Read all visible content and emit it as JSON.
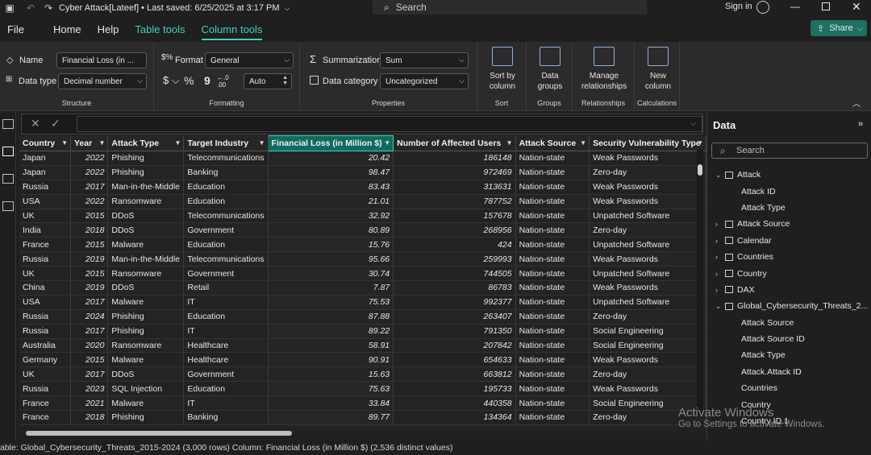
{
  "titlebar": {
    "title": "Cyber Attack[Lateef] • Last saved: 6/25/2025 at 3:17 PM",
    "search_placeholder": "Search",
    "sign_in": "Sign in"
  },
  "menu": {
    "file": "File",
    "home": "Home",
    "help": "Help",
    "table_tools": "Table tools",
    "column_tools": "Column tools",
    "share": "Share"
  },
  "ribbon": {
    "structure": {
      "name_label": "Name",
      "name_value": "Financial Loss (in ...",
      "datatype_label": "Data type",
      "datatype_value": "Decimal number",
      "group": "Structure"
    },
    "formatting": {
      "format_label": "Format",
      "format_value": "General",
      "decimals": "Auto",
      "group": "Formatting"
    },
    "properties": {
      "summarization_label": "Summarization",
      "summarization_value": "Sum",
      "category_label": "Data category",
      "category_value": "Uncategorized",
      "group": "Properties"
    },
    "sort": {
      "label_line1": "Sort by",
      "label_line2": "column",
      "group": "Sort"
    },
    "groups": {
      "label_line1": "Data",
      "label_line2": "groups",
      "group": "Groups"
    },
    "relationships": {
      "label_line1": "Manage",
      "label_line2": "relationships",
      "group": "Relationships"
    },
    "calculations": {
      "label_line1": "New",
      "label_line2": "column",
      "group": "Calculations"
    }
  },
  "table": {
    "columns": [
      "Country",
      "Year",
      "Attack Type",
      "Target Industry",
      "Financial Loss (in Million $)",
      "Number of Affected Users",
      "Attack Source",
      "Security Vulnerability Type"
    ],
    "rows": [
      [
        "Japan",
        "2022",
        "Phishing",
        "Telecommunications",
        "20.42",
        "186148",
        "Nation-state",
        "Weak Passwords"
      ],
      [
        "Japan",
        "2022",
        "Phishing",
        "Banking",
        "98.47",
        "972469",
        "Nation-state",
        "Zero-day"
      ],
      [
        "Russia",
        "2017",
        "Man-in-the-Middle",
        "Education",
        "83.43",
        "313631",
        "Nation-state",
        "Weak Passwords"
      ],
      [
        "USA",
        "2022",
        "Ransomware",
        "Education",
        "21.01",
        "787752",
        "Nation-state",
        "Weak Passwords"
      ],
      [
        "UK",
        "2015",
        "DDoS",
        "Telecommunications",
        "32.92",
        "157678",
        "Nation-state",
        "Unpatched Software"
      ],
      [
        "India",
        "2018",
        "DDoS",
        "Government",
        "80.89",
        "268956",
        "Nation-state",
        "Zero-day"
      ],
      [
        "France",
        "2015",
        "Malware",
        "Education",
        "15.76",
        "424",
        "Nation-state",
        "Unpatched Software"
      ],
      [
        "Russia",
        "2019",
        "Man-in-the-Middle",
        "Telecommunications",
        "95.66",
        "259993",
        "Nation-state",
        "Weak Passwords"
      ],
      [
        "UK",
        "2015",
        "Ransomware",
        "Government",
        "30.74",
        "744505",
        "Nation-state",
        "Unpatched Software"
      ],
      [
        "China",
        "2019",
        "DDoS",
        "Retail",
        "7.87",
        "86783",
        "Nation-state",
        "Weak Passwords"
      ],
      [
        "USA",
        "2017",
        "Malware",
        "IT",
        "75.53",
        "992377",
        "Nation-state",
        "Unpatched Software"
      ],
      [
        "Russia",
        "2024",
        "Phishing",
        "Education",
        "87.88",
        "263407",
        "Nation-state",
        "Zero-day"
      ],
      [
        "Russia",
        "2017",
        "Phishing",
        "IT",
        "89.22",
        "791350",
        "Nation-state",
        "Social Engineering"
      ],
      [
        "Australia",
        "2020",
        "Ransomware",
        "Healthcare",
        "58.91",
        "207842",
        "Nation-state",
        "Social Engineering"
      ],
      [
        "Germany",
        "2015",
        "Malware",
        "Healthcare",
        "90.91",
        "654633",
        "Nation-state",
        "Weak Passwords"
      ],
      [
        "UK",
        "2017",
        "DDoS",
        "Government",
        "15.63",
        "663812",
        "Nation-state",
        "Zero-day"
      ],
      [
        "Russia",
        "2023",
        "SQL Injection",
        "Education",
        "75.63",
        "195733",
        "Nation-state",
        "Weak Passwords"
      ],
      [
        "France",
        "2021",
        "Malware",
        "IT",
        "33.84",
        "440358",
        "Nation-state",
        "Social Engineering"
      ],
      [
        "France",
        "2018",
        "Phishing",
        "Banking",
        "89.77",
        "134364",
        "Nation-state",
        "Zero-day"
      ]
    ]
  },
  "data_pane": {
    "title": "Data",
    "search_placeholder": "Search",
    "items": [
      {
        "label": "Attack",
        "level": 0,
        "expanded": true,
        "table": true
      },
      {
        "label": "Attack ID",
        "level": 1
      },
      {
        "label": "Attack Type",
        "level": 1
      },
      {
        "label": "Attack Source",
        "level": 0,
        "expanded": false,
        "table": true
      },
      {
        "label": "Calendar",
        "level": 0,
        "expanded": false,
        "table": true
      },
      {
        "label": "Countries",
        "level": 0,
        "expanded": false,
        "table": true
      },
      {
        "label": "Country",
        "level": 0,
        "expanded": false,
        "table": true
      },
      {
        "label": "DAX",
        "level": 0,
        "expanded": false,
        "table": true
      },
      {
        "label": "Global_Cybersecurity_Threats_2...",
        "level": 0,
        "expanded": true,
        "table": true
      },
      {
        "label": "Attack Source",
        "level": 1
      },
      {
        "label": "Attack Source ID",
        "level": 1
      },
      {
        "label": "Attack Type",
        "level": 1
      },
      {
        "label": "Attack.Attack ID",
        "level": 1
      },
      {
        "label": "Countries",
        "level": 1
      },
      {
        "label": "Country",
        "level": 1
      },
      {
        "label": "Country ID.1",
        "level": 1
      }
    ]
  },
  "statusbar": {
    "text": "able: Global_Cybersecurity_Threats_2015-2024 (3,000 rows) Column: Financial Loss (in Million $) (2,536 distinct values)"
  },
  "watermark": {
    "line1": "Activate Windows",
    "line2": "Go to Settings to activate Windows."
  },
  "colors": {
    "accent": "#3fd1bc",
    "share_bg": "#1f6f62"
  },
  "icons": [
    "save-icon",
    "undo-icon",
    "redo-icon",
    "search-icon",
    "avatar-icon",
    "minimize-icon",
    "maximize-icon",
    "close-icon",
    "share-icon",
    "report-view-icon",
    "table-view-icon",
    "model-view-icon",
    "dax-query-icon"
  ]
}
